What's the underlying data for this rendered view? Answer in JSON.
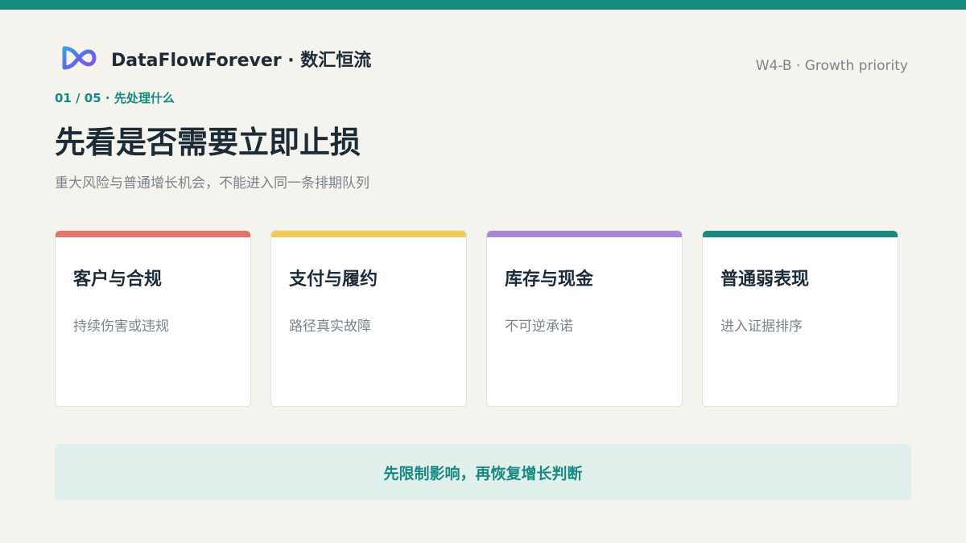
{
  "brand": {
    "name": "DataFlowForever · 数汇恒流",
    "logo_icon": "infinity-logo-icon"
  },
  "doc_tag": "W4-B · Growth priority",
  "step": "01 / 05 · 先处理什么",
  "headline": "先看是否需要立即止损",
  "subline": "重大风险与普通增长机会，不能进入同一条排期队列",
  "cards": [
    {
      "title": "客户与合规",
      "desc": "持续伤害或违规",
      "color": "#e0766a"
    },
    {
      "title": "支付与履约",
      "desc": "路径真实故障",
      "color": "#f0cc57"
    },
    {
      "title": "库存与现金",
      "desc": "不可逆承诺",
      "color": "#a987d6"
    },
    {
      "title": "普通弱表现",
      "desc": "进入证据排序",
      "color": "#178a80"
    }
  ],
  "banner": "先限制影响，再恢复增长判断",
  "colors": {
    "accent": "#178a80",
    "background": "#f4f3ee",
    "banner_bg": "#e1f0ed"
  }
}
